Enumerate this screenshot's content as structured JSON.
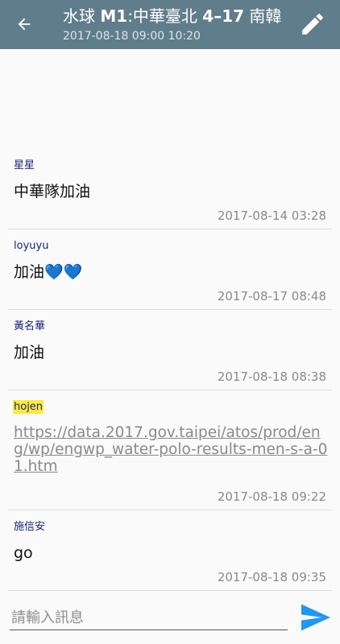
{
  "header": {
    "title_prefix": "水球 ",
    "title_strong1": "M1",
    "title_mid": ":中華臺北 ",
    "title_strong2": "4–17",
    "title_suffix": " 南韓",
    "subtitle": "2017-08-18 09:00 10:20",
    "back_icon": "arrow-left",
    "edit_icon": "pencil"
  },
  "messages": [
    {
      "author": "星星",
      "body": "中華隊加油",
      "time": "2017-08-14 03:28"
    },
    {
      "author": "loyuyu",
      "body_text": "加油",
      "body_hearts": "💙💙",
      "time": "2017-08-17 08:48"
    },
    {
      "author": "黃名華",
      "body": "加油",
      "time": "2017-08-18 08:38"
    },
    {
      "author": "hojen",
      "body": "https://data.2017.gov.taipei/atos/prod/eng/wp/engwp_water-polo-results-men-s-a-01.htm",
      "time": "2017-08-18 09:22"
    },
    {
      "author": "施信安",
      "body": "go",
      "time": "2017-08-18 09:35"
    }
  ],
  "composer": {
    "placeholder": "請輸入訊息",
    "send_icon": "send"
  },
  "colors": {
    "appbar": "#607d8b",
    "author": "#1a237e",
    "highlight": "#ffeb3b",
    "send": "#2196f3"
  }
}
